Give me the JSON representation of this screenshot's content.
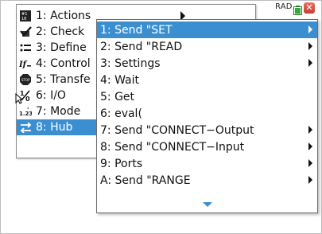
{
  "status_bar": {
    "mode": "RAD",
    "battery_icon": "battery-icon",
    "close_label": "✕"
  },
  "main_menu": {
    "items": [
      {
        "label": "1: Actions",
        "icon": "actions-icon"
      },
      {
        "label": "2: Check",
        "icon": "check-icon"
      },
      {
        "label": "3: Define",
        "icon": "define-icon"
      },
      {
        "label": "4: Control",
        "icon": "control-icon"
      },
      {
        "label": "5: Transfe",
        "icon": "transfer-icon"
      },
      {
        "label": "6: I/O",
        "icon": "io-icon"
      },
      {
        "label": "7: Mode",
        "icon": "mode-icon"
      },
      {
        "label": "8: Hub",
        "icon": "hub-icon"
      }
    ],
    "selected_index": 7
  },
  "submenu": {
    "items": [
      {
        "label": "1: Send \"SET",
        "has_submenu": true
      },
      {
        "label": "2: Send \"READ",
        "has_submenu": true
      },
      {
        "label": "3: Settings",
        "has_submenu": true
      },
      {
        "label": "4: Wait",
        "has_submenu": false
      },
      {
        "label": "5: Get",
        "has_submenu": false
      },
      {
        "label": "6: eval(",
        "has_submenu": false
      },
      {
        "label": "7: Send \"CONNECT−Output",
        "has_submenu": true
      },
      {
        "label": "8: Send \"CONNECT−Input",
        "has_submenu": true
      },
      {
        "label": "9: Ports",
        "has_submenu": true
      },
      {
        "label": "A: Send \"RANGE",
        "has_submenu": true
      }
    ],
    "highlighted_index": 0,
    "more_indicator": "scroll-down-icon"
  },
  "colors": {
    "highlight": "#3b8fd1",
    "close_button": "#d9473a"
  }
}
